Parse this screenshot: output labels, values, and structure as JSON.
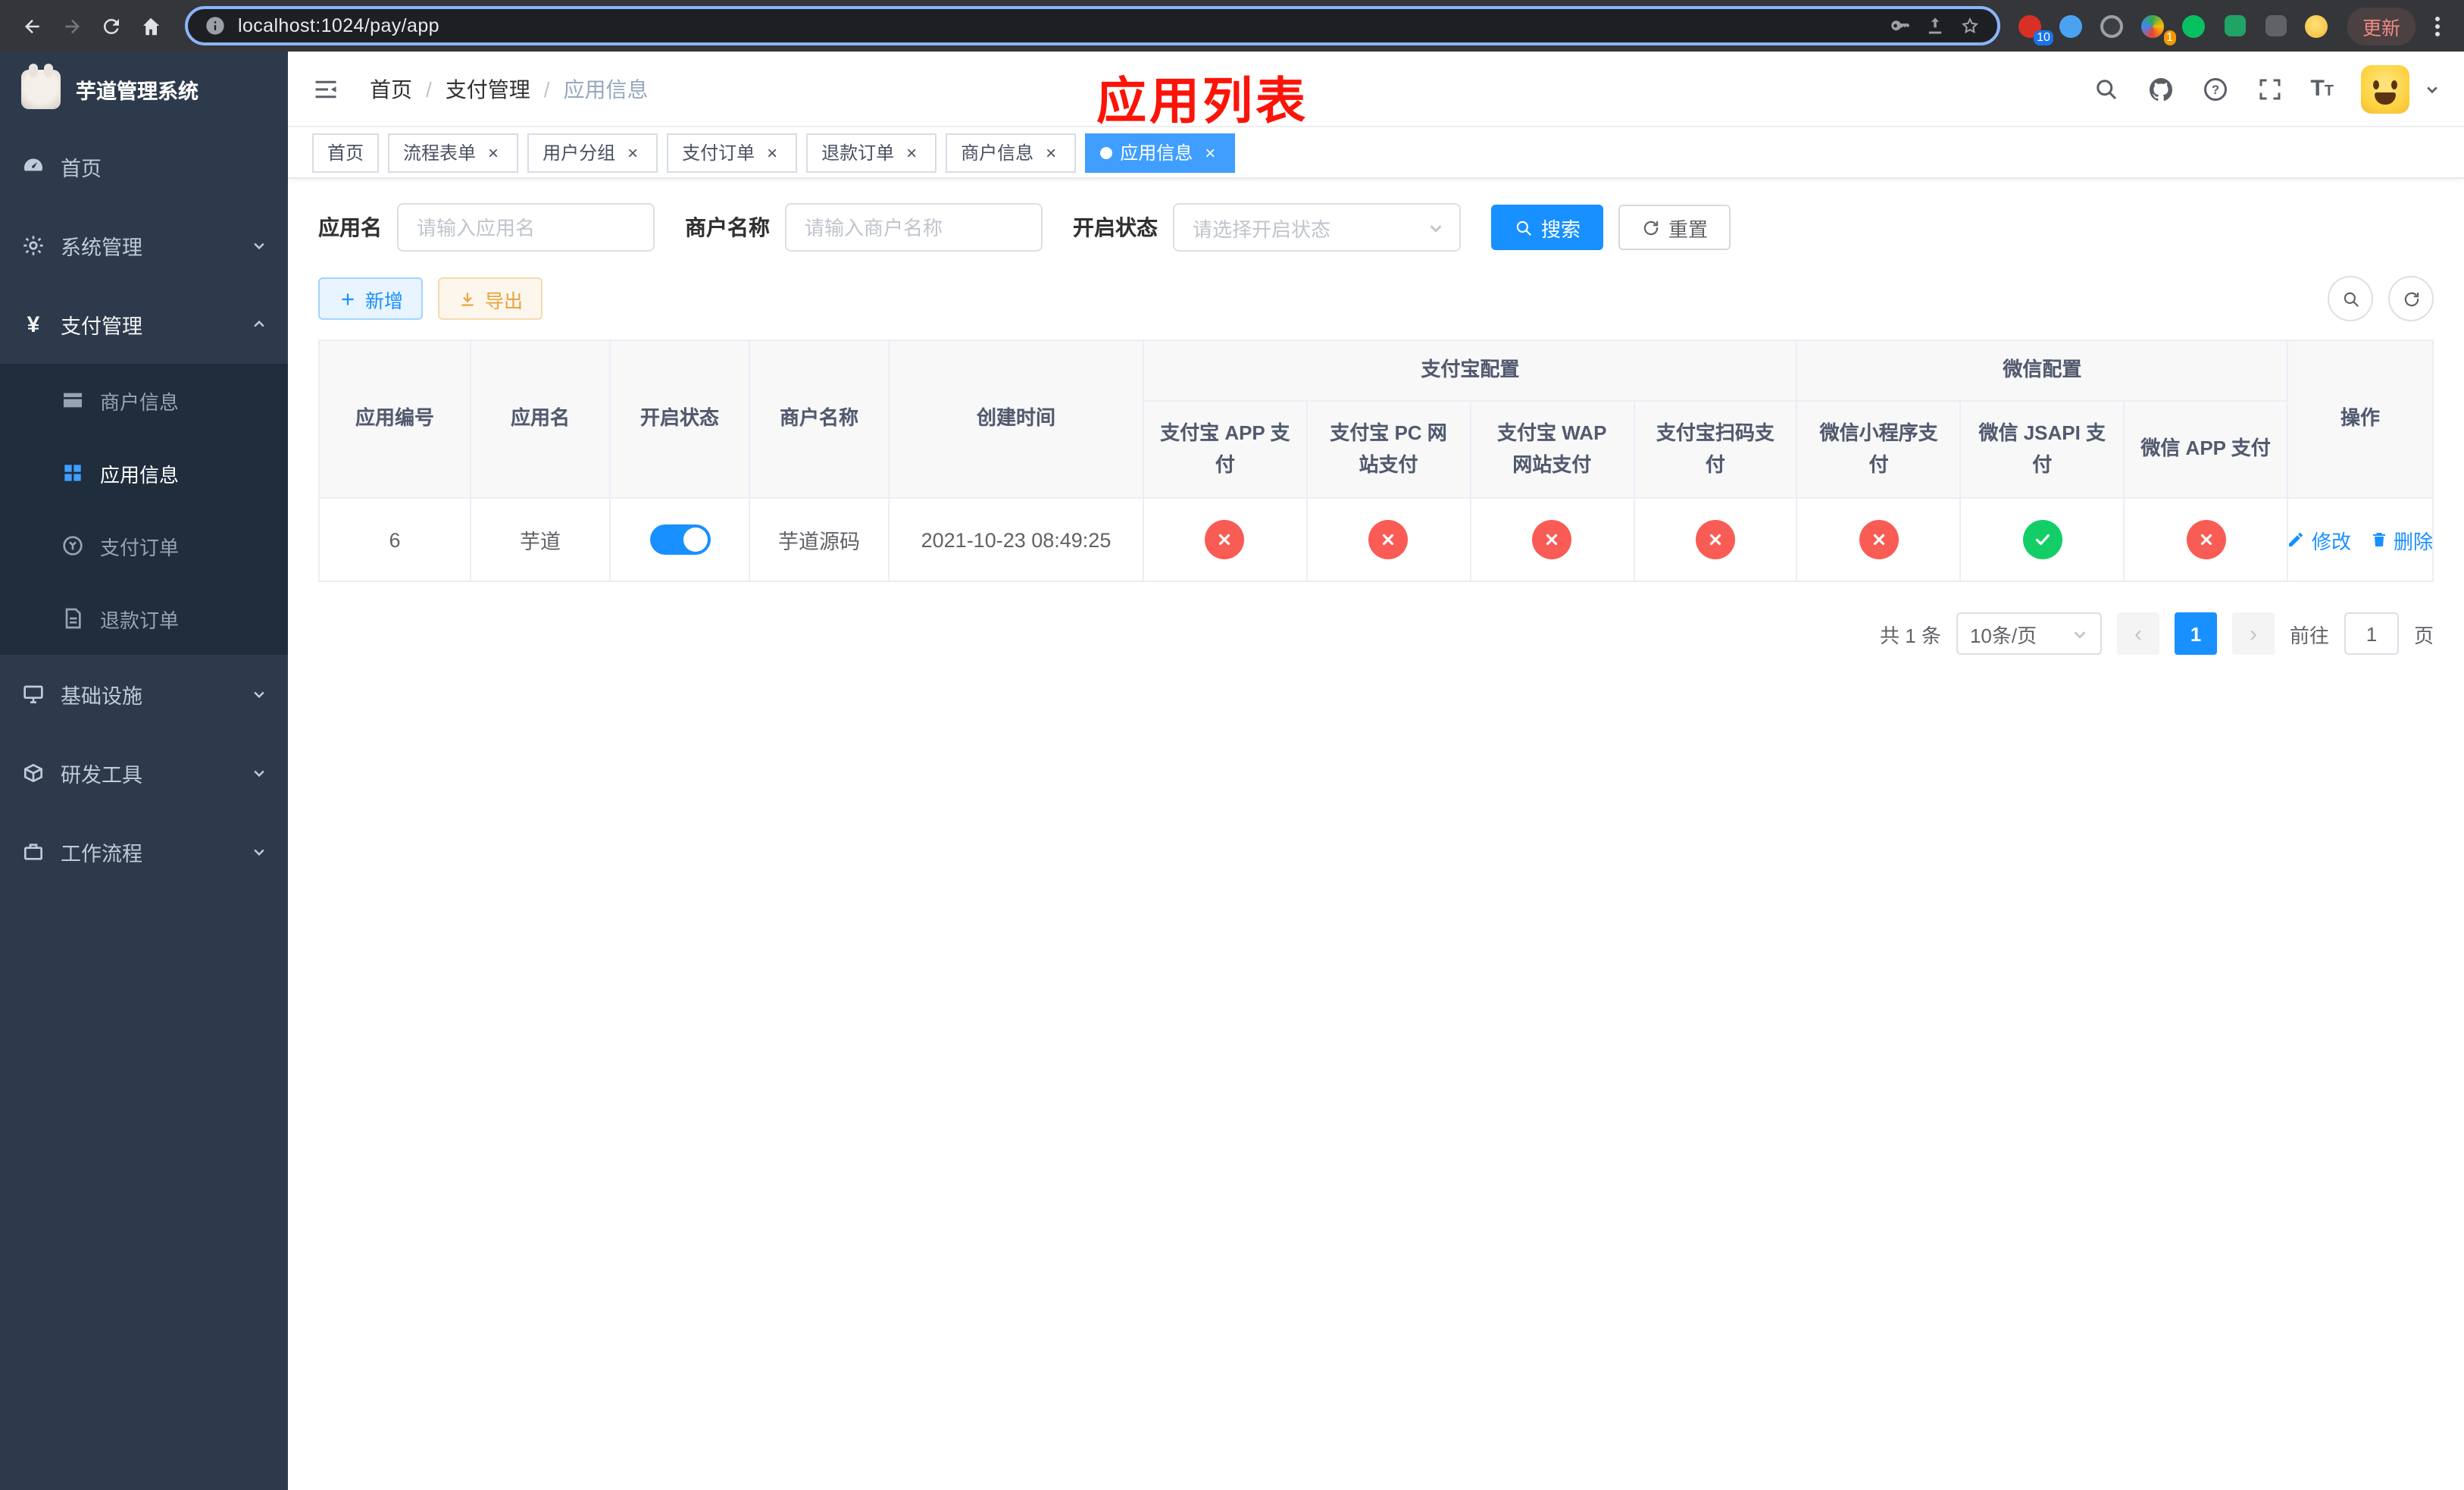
{
  "colors": {
    "accent_blue": "#1890ff",
    "tab_active_blue": "#409eff",
    "sidebar_bg": "#2d3a4b",
    "submenu_bg": "#1f2d3d",
    "status_error_red": "#f95c55",
    "status_success_green": "#13ce66",
    "warning_orange": "#e6a23c",
    "overlay_red": "#fb1407",
    "browser_bar_bg": "#35363a",
    "urlbar_focus_ring": "#8ab4f8"
  },
  "icons": {
    "back-icon": "left-arrow",
    "forward-icon": "right-arrow",
    "reload-icon": "circular-arrow",
    "home-icon": "house",
    "info-icon": "circled-i",
    "key-icon": "key",
    "share-icon": "upload-arrow",
    "star-icon": "star-outline",
    "browser-menu-icon": "vertical-dots",
    "hamburger-icon": "fold-menu-lines",
    "search-icon": "magnifier",
    "github-icon": "octocat",
    "help-icon": "circled-question",
    "fullscreen-icon": "corner-brackets",
    "font-size-icon": "T",
    "caret-down-icon": "triangle-down",
    "plus-icon": "+",
    "download-icon": "down-arrow-tray",
    "refresh-icon": "circular-arrows",
    "edit-icon": "pencil",
    "delete-icon": "trash",
    "close-icon": "x",
    "check-icon": "checkmark",
    "chevron-down-icon": "v"
  },
  "browser": {
    "url": "localhost:1024/pay/app",
    "update_label": "更新",
    "extension_badge_1": "10",
    "extension_badge_2": "1"
  },
  "sidebar": {
    "title": "芋道管理系统",
    "items": [
      {
        "label": "首页"
      },
      {
        "label": "系统管理"
      },
      {
        "label": "支付管理"
      },
      {
        "label": "基础设施"
      },
      {
        "label": "研发工具"
      },
      {
        "label": "工作流程"
      }
    ],
    "payment_children": [
      {
        "label": "商户信息"
      },
      {
        "label": "应用信息"
      },
      {
        "label": "支付订单"
      },
      {
        "label": "退款订单"
      }
    ]
  },
  "header": {
    "breadcrumb_1": "首页",
    "breadcrumb_2": "支付管理",
    "breadcrumb_3": "应用信息",
    "overlay_title": "应用列表"
  },
  "tabs": [
    {
      "label": "首页"
    },
    {
      "label": "流程表单"
    },
    {
      "label": "用户分组"
    },
    {
      "label": "支付订单"
    },
    {
      "label": "退款订单"
    },
    {
      "label": "商户信息"
    },
    {
      "label": "应用信息"
    }
  ],
  "filters": {
    "app_name_label": "应用名",
    "app_name_placeholder": "请输入应用名",
    "merchant_label": "商户名称",
    "merchant_placeholder": "请输入商户名称",
    "status_label": "开启状态",
    "status_placeholder": "请选择开启状态",
    "search_label": "搜索",
    "reset_label": "重置"
  },
  "toolbar": {
    "add_label": "新增",
    "export_label": "导出"
  },
  "table": {
    "headers": {
      "app_id": "应用编号",
      "app_name": "应用名",
      "status": "开启状态",
      "merchant": "商户名称",
      "created": "创建时间",
      "actions": "操作",
      "alipay_group": "支付宝配置",
      "wechat_group": "微信配置",
      "alipay_app": "支付宝 APP 支付",
      "alipay_pc": "支付宝 PC 网站支付",
      "alipay_wap": "支付宝 WAP 网站支付",
      "alipay_qr": "支付宝扫码支付",
      "wx_mini": "微信小程序支付",
      "wx_jsapi": "微信 JSAPI 支付",
      "wx_app": "微信 APP 支付"
    },
    "rows": [
      {
        "app_id": "6",
        "app_name": "芋道",
        "enabled": true,
        "merchant": "芋道源码",
        "created": "2021-10-23 08:49:25",
        "alipay_app": "disabled",
        "alipay_pc": "disabled",
        "alipay_wap": "disabled",
        "alipay_qr": "disabled",
        "wx_mini": "disabled",
        "wx_jsapi": "enabled",
        "wx_app": "disabled",
        "edit_label": "修改",
        "delete_label": "删除"
      }
    ]
  },
  "pagination": {
    "total": "共 1 条",
    "page_size": "10条/页",
    "page": "1",
    "goto_label": "前往",
    "goto_value": "1",
    "page_unit": "页"
  }
}
